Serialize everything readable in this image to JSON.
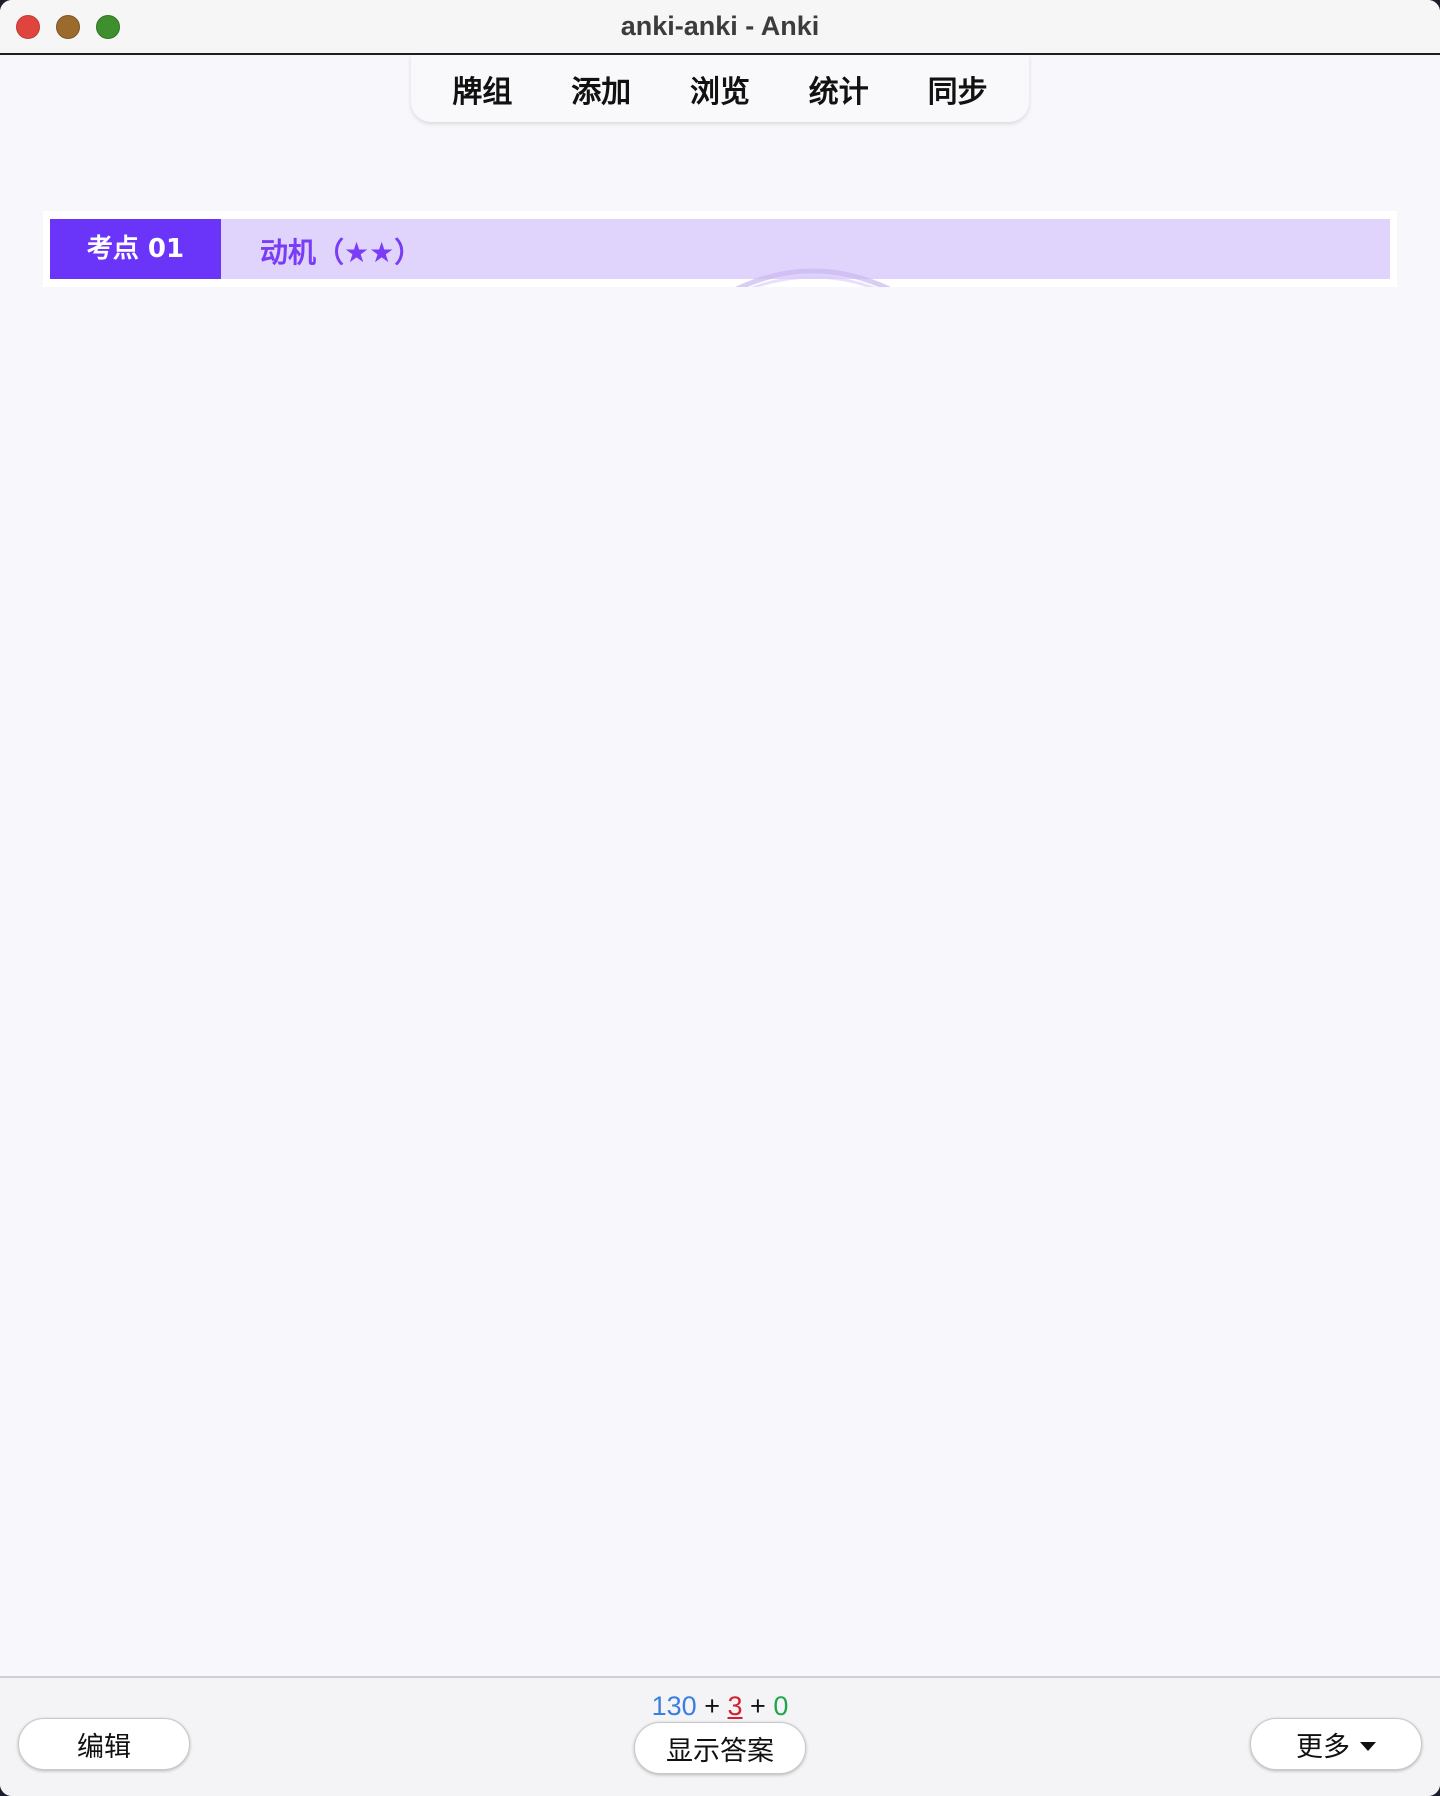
{
  "window": {
    "title": "anki-anki - Anki"
  },
  "toolbar": {
    "items": [
      {
        "label": "牌组"
      },
      {
        "label": "添加"
      },
      {
        "label": "浏览"
      },
      {
        "label": "统计"
      },
      {
        "label": "同步"
      }
    ]
  },
  "card": {
    "badge": "考点 01",
    "topic": "动机（★★）",
    "colors": {
      "badge_bg": "#6a34f9",
      "bar_bg": "#e0d4fd",
      "topic_text": "#7a3df5"
    }
  },
  "bottom": {
    "counts": {
      "new": "130",
      "learning": "3",
      "review": "0",
      "separator": "+"
    },
    "edit_label": "编辑",
    "show_answer_label": "显示答案",
    "more_label": "更多"
  }
}
